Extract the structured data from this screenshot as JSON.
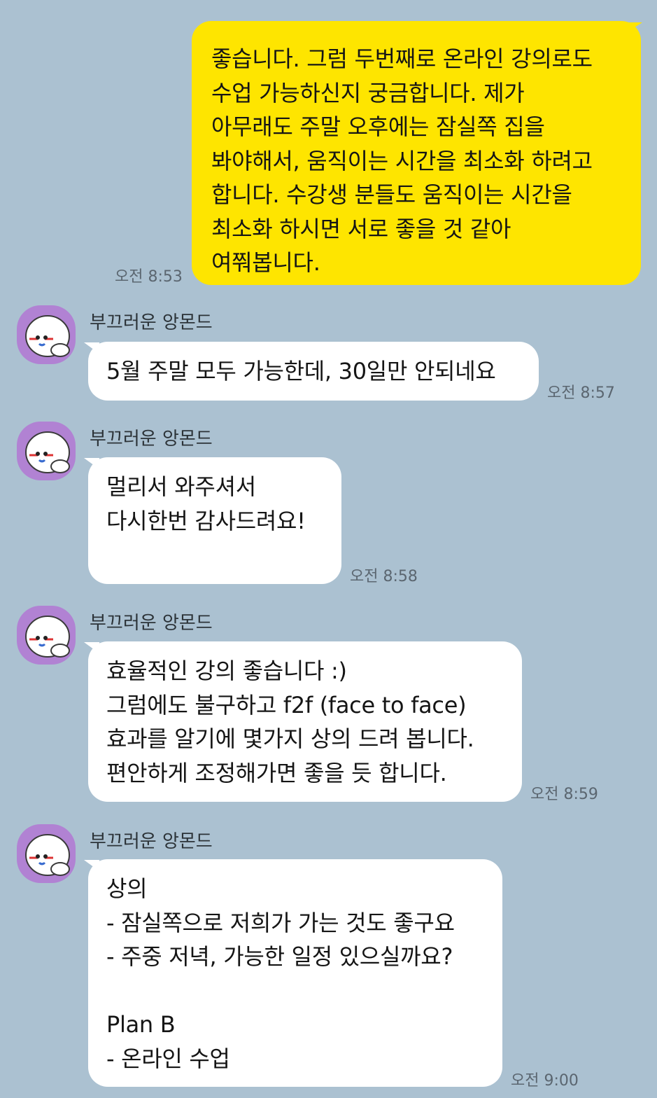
{
  "chat": {
    "messages": [
      {
        "from": "me",
        "text": "좋습니다. 그럼 두번째로 온라인 강의로도\n수업 가능하신지 궁금합니다. 제가\n아무래도 주말 오후에는 잠실쪽 집을\n봐야해서, 움직이는 시간을 최소화 하려고\n합니다. 수강생 분들도 움직이는 시간을\n최소화 하시면 서로 좋을 것 같아\n여쭤봅니다.",
        "time": "오전 8:53"
      },
      {
        "from": "other",
        "sender": "부끄러운 앙몬드",
        "text": "5월 주말 모두 가능한데, 30일만 안되네요",
        "time": "오전 8:57"
      },
      {
        "from": "other",
        "sender": "부끄러운 앙몬드",
        "text": "멀리서 와주셔서\n다시한번 감사드려요!",
        "time": "오전 8:58"
      },
      {
        "from": "other",
        "sender": "부끄러운 앙몬드",
        "text": "효율적인 강의 좋습니다 :)\n그럼에도 불구하고 f2f (face to face)\n효과를 알기에 몇가지 상의 드려 봅니다.\n편안하게 조정해가면 좋을 듯 합니다.",
        "time": "오전 8:59"
      },
      {
        "from": "other",
        "sender": "부끄러운 앙몬드",
        "text": "상의\n- 잠실쪽으로 저희가 가는 것도 좋구요\n- 주중 저녁, 가능한 일정 있으실까요?\n\nPlan B\n- 온라인 수업",
        "time": "오전 9:00"
      }
    ]
  },
  "colors": {
    "background": "#abc1d1",
    "my_bubble": "#fee500",
    "other_bubble": "#ffffff",
    "avatar_bg": "#b182d3"
  },
  "icons": {
    "avatar": "avatar-almond-character-icon"
  }
}
